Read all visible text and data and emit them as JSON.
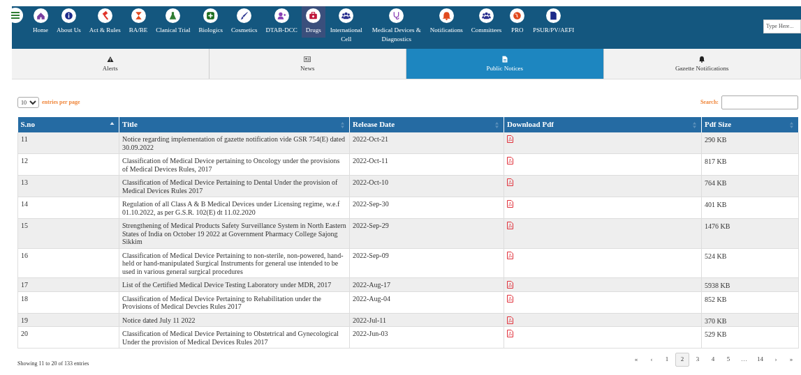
{
  "nav": {
    "items": [
      {
        "label": "Home",
        "selected": false
      },
      {
        "label": "About Us",
        "selected": false
      },
      {
        "label": "Act & Rules",
        "selected": false
      },
      {
        "label": "BA/BE",
        "selected": false
      },
      {
        "label": "Clanical Trial",
        "selected": false
      },
      {
        "label": "Biologics",
        "selected": false
      },
      {
        "label": "Cosmetics",
        "selected": false
      },
      {
        "label": "DTAB-DCC",
        "selected": false
      },
      {
        "label": "Drugs",
        "selected": true
      },
      {
        "label": "International Cell",
        "selected": false
      },
      {
        "label": "Medical Devices & Diagnostics",
        "selected": false
      },
      {
        "label": "Notifications",
        "selected": false
      },
      {
        "label": "Committees",
        "selected": false
      },
      {
        "label": "PRO",
        "selected": false
      },
      {
        "label": "PSUR/PV/AEFI",
        "selected": false
      }
    ],
    "search": {
      "placeholder": "Type Here..."
    }
  },
  "tabs": [
    {
      "label": "Alerts",
      "selected": false
    },
    {
      "label": "News",
      "selected": false
    },
    {
      "label": "Public Notices",
      "selected": true
    },
    {
      "label": "Gazette Notifications",
      "selected": false
    }
  ],
  "length": {
    "value": "10",
    "label": "entries per page"
  },
  "filter": {
    "label": "Search:"
  },
  "table": {
    "columns": [
      {
        "label": "S.no",
        "sorted": true
      },
      {
        "label": "Title",
        "sorted": false
      },
      {
        "label": "Release Date",
        "sorted": false
      },
      {
        "label": "Download Pdf",
        "sorted": false
      },
      {
        "label": "Pdf Size",
        "sorted": false
      }
    ],
    "rows": [
      {
        "sno": "11",
        "title": "Notice regarding implementation of gazette notification vide GSR 754(E) dated 30.09.2022",
        "date": "2022-Oct-21",
        "size": "290 KB"
      },
      {
        "sno": "12",
        "title": "Classification of Medical Device pertaining to Oncology under the provisions of Medical Devices Rules, 2017",
        "date": "2022-Oct-11",
        "size": "817 KB"
      },
      {
        "sno": "13",
        "title": "Classification of Medical Device Pertaining to Dental Under the provision of Medical Devices Rules 2017",
        "date": "2022-Oct-10",
        "size": "764 KB"
      },
      {
        "sno": "14",
        "title": "Regulation of all Class A & B Medical Devices under Licensing regime, w.e.f 01.10.2022, as per G.S.R. 102(E) dt 11.02.2020",
        "date": "2022-Sep-30",
        "size": "401 KB"
      },
      {
        "sno": "15",
        "title": "Strengthening of Medical Products Safety Surveillance System in North Eastern States of India on October 19 2022 at Government Pharmacy College Sajong Sikkim",
        "date": "2022-Sep-29",
        "size": "1476 KB"
      },
      {
        "sno": "16",
        "title": "Classification of Medical Device Pertaining to non-sterile, non-powered, hand-held or hand-manipulated Surgical Instruments for general use intended to be used in various general surgical procedures",
        "date": "2022-Sep-09",
        "size": "524 KB"
      },
      {
        "sno": "17",
        "title": "List of the Certified Medical Device Testing Laboratory under MDR, 2017",
        "date": "2022-Aug-17",
        "size": "5938 KB"
      },
      {
        "sno": "18",
        "title": "Classification of Medical Device Pertaining to Rehabilitation under the Provisions of Medical Devcies Rules 2017",
        "date": "2022-Aug-04",
        "size": "852 KB"
      },
      {
        "sno": "19",
        "title": "Notice dated July 11 2022",
        "date": "2022-Jul-11",
        "size": "370 KB"
      },
      {
        "sno": "20",
        "title": "Classification of Medical Device Pertaining to Obstetrical and Gynecological Under the provision of Medical Devices Rules 2017",
        "date": "2022-Jun-03",
        "size": "529 KB"
      }
    ]
  },
  "info": "Showing 11 to 20 of 133 entries",
  "pagination": [
    {
      "label": "«",
      "selected": false
    },
    {
      "label": "‹",
      "selected": false
    },
    {
      "label": "1",
      "selected": false
    },
    {
      "label": "2",
      "selected": true
    },
    {
      "label": "3",
      "selected": false
    },
    {
      "label": "4",
      "selected": false
    },
    {
      "label": "5",
      "selected": false
    },
    {
      "label": "…",
      "selected": false
    },
    {
      "label": "14",
      "selected": false
    },
    {
      "label": "›",
      "selected": false
    },
    {
      "label": "»",
      "selected": false
    }
  ]
}
